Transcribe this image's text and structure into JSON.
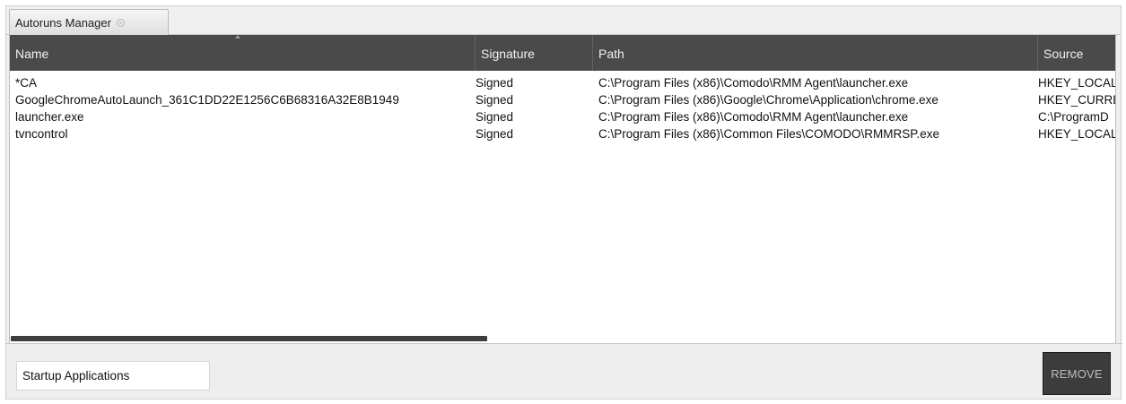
{
  "tab": {
    "title": "Autoruns Manager",
    "close_icon": "close-icon"
  },
  "columns": [
    "Name",
    "Signature",
    "Path",
    "Source"
  ],
  "rows": [
    {
      "name": "*CA",
      "signature": "Signed",
      "path": "C:\\Program Files (x86)\\Comodo\\RMM Agent\\launcher.exe",
      "source": "HKEY_LOCAL"
    },
    {
      "name": "GoogleChromeAutoLaunch_361C1DD22E1256C6B68316A32E8B1949",
      "signature": "Signed",
      "path": "C:\\Program Files (x86)\\Google\\Chrome\\Application\\chrome.exe",
      "source": "HKEY_CURRE"
    },
    {
      "name": "launcher.exe",
      "signature": "Signed",
      "path": "C:\\Program Files (x86)\\Comodo\\RMM Agent\\launcher.exe",
      "source": "C:\\ProgramD"
    },
    {
      "name": "tvncontrol",
      "signature": "Signed",
      "path": "C:\\Program Files (x86)\\Common Files\\COMODO\\RMMRSP.exe",
      "source": "HKEY_LOCAL"
    }
  ],
  "filter": {
    "value": "Startup Applications"
  },
  "buttons": {
    "remove": "REMOVE"
  },
  "colors": {
    "header_bg": "#4a4a4a",
    "button_bg": "#3c3c3c"
  }
}
